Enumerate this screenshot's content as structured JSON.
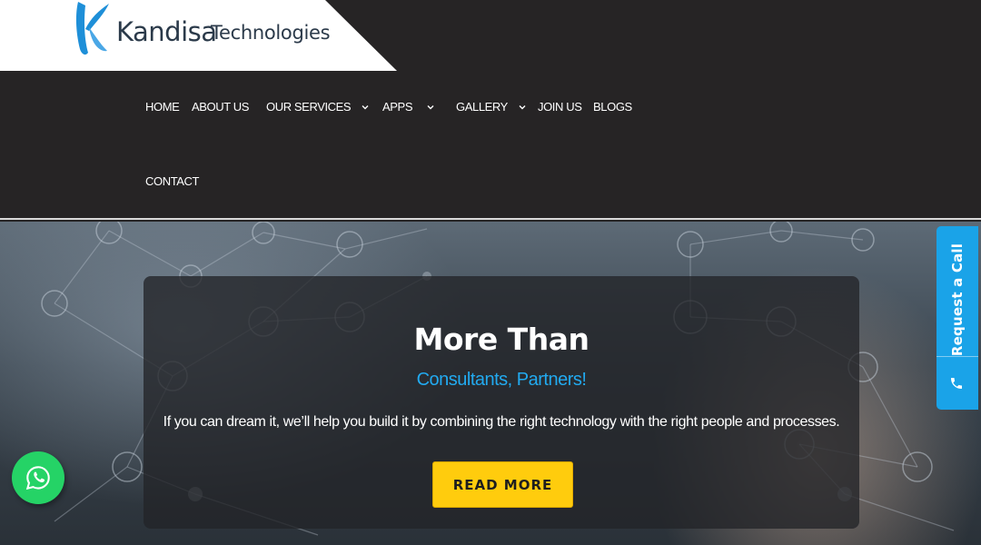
{
  "logo": {
    "name": "Kandisa",
    "sub": "Technologies"
  },
  "nav": {
    "items": [
      {
        "label": "HOME"
      },
      {
        "label": "ABOUT US"
      },
      {
        "label": "OUR SERVICES"
      },
      {
        "label": "APPS"
      },
      {
        "label": "GALLERY"
      },
      {
        "label": "JOIN US"
      },
      {
        "label": "BLOGS"
      },
      {
        "label": "CONTACT"
      }
    ]
  },
  "hero": {
    "title": "More Than",
    "subtitle": "Consultants, Partners!",
    "description": "If you can dream it, we’ll help you build it by combining the right technology with the right people and processes.",
    "button": "READ MORE"
  },
  "request_call": {
    "label": "Request a Call",
    "icon": "phone-icon"
  },
  "whatsapp": {
    "icon": "whatsapp-icon"
  },
  "colors": {
    "header_bg": "#262425",
    "accent_blue": "#22aaf0",
    "button_yellow": "#ffcc0d",
    "whatsapp_green": "#25d366"
  }
}
